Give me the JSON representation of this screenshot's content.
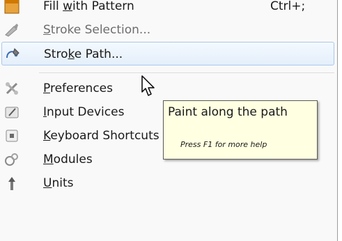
{
  "menu": {
    "items": [
      {
        "label": "Fill with Pattern",
        "mnemonic": "w",
        "shortcut": "Ctrl+;",
        "icon": "pattern-fill-icon",
        "disabled": false
      },
      {
        "label": "Stroke Selection...",
        "mnemonic": "S",
        "shortcut": "",
        "icon": "stroke-selection-icon",
        "disabled": true
      },
      {
        "label": "Stroke Path...",
        "mnemonic": "k",
        "shortcut": "",
        "icon": "stroke-path-icon",
        "disabled": false,
        "hovered": true
      },
      {
        "label": "Preferences",
        "mnemonic": "P",
        "shortcut": "",
        "icon": "preferences-icon",
        "disabled": false
      },
      {
        "label": "Input Devices",
        "mnemonic": "I",
        "shortcut": "",
        "icon": "input-devices-icon",
        "disabled": false
      },
      {
        "label": "Keyboard Shortcuts",
        "mnemonic": "K",
        "shortcut": "",
        "icon": "keyboard-shortcuts-icon",
        "disabled": false
      },
      {
        "label": "Modules",
        "mnemonic": "M",
        "shortcut": "",
        "icon": "modules-icon",
        "disabled": false
      },
      {
        "label": "Units",
        "mnemonic": "U",
        "shortcut": "",
        "icon": "units-icon",
        "disabled": false
      }
    ]
  },
  "tooltip": {
    "title": "Paint along the path",
    "help": "Press F1 for more help"
  },
  "colors": {
    "hover_border": "#a9c8ea",
    "tooltip_background": "#ffffe1",
    "disabled_text": "#6d6d6d"
  }
}
